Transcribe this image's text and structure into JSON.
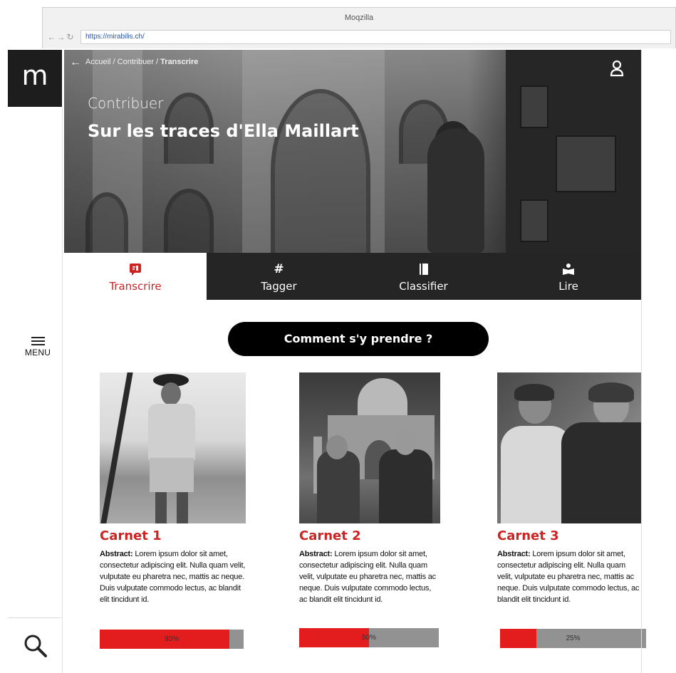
{
  "browser": {
    "window_title": "Moqzilla",
    "url": "https://mirabilis.ch/"
  },
  "sidebar": {
    "logo_letter": "m",
    "menu_label": "MENU"
  },
  "hero": {
    "breadcrumb": {
      "home": "Accueil",
      "separator1": " / ",
      "parent": "Contribuer",
      "separator2": " / ",
      "current": "Transcrire"
    },
    "kicker": "Contribuer",
    "title": "Sur les traces d'Ella Maillart"
  },
  "tabs": [
    {
      "label": "Transcrire",
      "icon": "transcribe-icon",
      "active": true
    },
    {
      "label": "Tagger",
      "icon": "hash-icon",
      "active": false
    },
    {
      "label": "Classifier",
      "icon": "book-icon",
      "active": false
    },
    {
      "label": "Lire",
      "icon": "reader-icon",
      "active": false
    }
  ],
  "help_button": "Comment s'y prendre ?",
  "cards": [
    {
      "title": "Carnet 1",
      "abstract_label": "Abstract:",
      "abstract_text": " Lorem ipsum dolor sit amet, consectetur adipiscing elit. Nulla quam velit, vulputate eu pharetra nec, mattis ac neque. Duis vulputate commodo lectus, ac blandit elit tincidunt id.",
      "progress": 90,
      "progress_label": "90%"
    },
    {
      "title": "Carnet 2",
      "abstract_label": "Abstract:",
      "abstract_text": " Lorem ipsum dolor sit amet, consectetur adipiscing elit. Nulla quam velit, vulputate eu pharetra nec, mattis ac neque. Duis vulputate commodo lectus, ac blandit elit tincidunt id.",
      "progress": 50,
      "progress_label": "50%"
    },
    {
      "title": "Carnet 3",
      "abstract_label": "Abstract:",
      "abstract_text": " Lorem ipsum dolor sit amet, consectetur adipiscing elit. Nulla quam velit, vulputate eu pharetra nec, mattis ac neque. Duis vulputate commodo lectus, ac blandit elit tincidunt id.",
      "progress": 25,
      "progress_label": "25%"
    }
  ],
  "colors": {
    "accent": "#cc2323",
    "progress_fill": "#e31d1d",
    "progress_track": "#929292",
    "dark": "#252525"
  }
}
